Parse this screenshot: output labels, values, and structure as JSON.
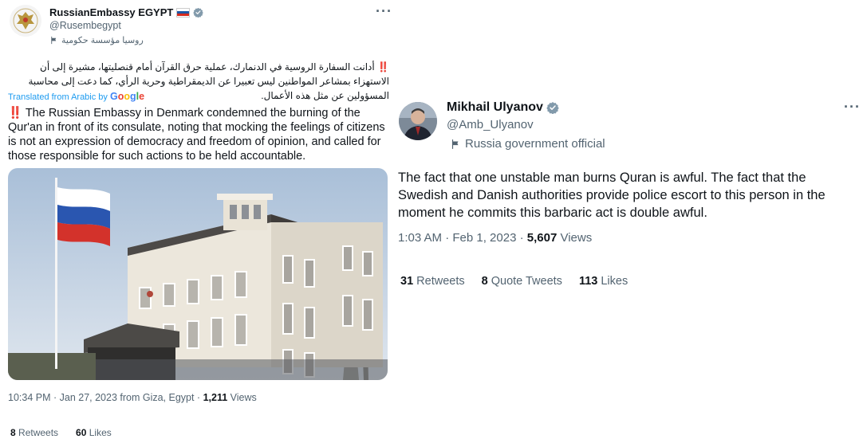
{
  "left_tweet": {
    "author_name": "RussianEmbassy EGYPT",
    "handle": "@Rusembegypt",
    "label": "روسيا مؤسسة حكومية",
    "arabic_text": "‼️ أدانت السفارة الروسية في الدنمارك، عملية حرق القرآن أمام قنصليتها، مشيرة إلى أن الاستهزاء بمشاعر المواطنين ليس تعبيرا عن الديمقراطية وحرية الرأي، كما دعت إلى محاسبة المسؤولين عن مثل هذه الأعمال.",
    "translated_prefix": "Translated from Arabic by",
    "translated_brand": "Google",
    "text": "‼️ The Russian Embassy in Denmark condemned the burning of the Qur'an in front of its consulate, noting that mocking the feelings of citizens is not an expression of democracy and freedom of opinion, and called for those responsible for such actions to be held accountable.",
    "timestamp": "10:34 PM · Jan 27, 2023 from Giza, Egypt · ",
    "views_count": "1,211",
    "views_label": " Views",
    "retweets_count": "8",
    "retweets_label": " Retweets",
    "likes_count": "60",
    "likes_label": " Likes"
  },
  "right_tweet": {
    "author_name": "Mikhail Ulyanov",
    "handle": "@Amb_Ulyanov",
    "label": "Russia government official",
    "text": "The fact that one unstable man burns Quran is awful. The fact that the Swedish and Danish authorities provide police escort to this person in the moment he commits this barbaric act is double awful.",
    "timestamp": "1:03 AM · Feb 1, 2023 · ",
    "views_count": "5,607",
    "views_label": " Views",
    "retweets_count": "31",
    "retweets_label": " Retweets",
    "quotes_count": "8",
    "quotes_label": " Quote Tweets",
    "likes_count": "113",
    "likes_label": " Likes"
  },
  "colors": {
    "verified": "#829aab",
    "link": "#1d9bf0",
    "secondary_text": "#536471",
    "primary_text": "#0f1419"
  },
  "icons": [
    "verified-badge-icon",
    "flag-label-icon",
    "more-options-icon",
    "russia-flag-icon"
  ]
}
